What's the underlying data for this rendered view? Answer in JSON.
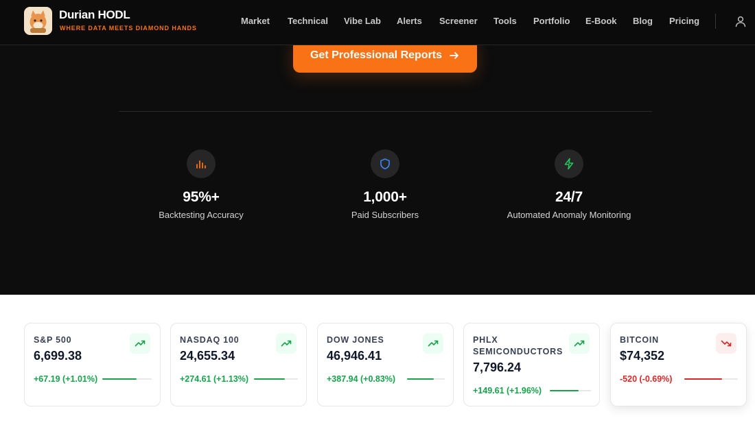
{
  "brand": {
    "title": "Durian HODL",
    "tagline": "WHERE DATA MEETS DIAMOND HANDS"
  },
  "nav": [
    {
      "label": "Market"
    },
    {
      "label": "Technical"
    },
    {
      "label": "Vibe Lab"
    },
    {
      "label": "Alerts"
    },
    {
      "label": "Screener"
    },
    {
      "label": "Tools"
    },
    {
      "label": "Portfolio"
    },
    {
      "label": "E-Book"
    },
    {
      "label": "Blog"
    },
    {
      "label": "Pricing"
    }
  ],
  "cta": {
    "label": "Get Professional Reports"
  },
  "stats": [
    {
      "value": "95%+",
      "label": "Backtesting Accuracy",
      "icon": "bar-chart-icon",
      "color": "#f97316"
    },
    {
      "value": "1,000+",
      "label": "Paid Subscribers",
      "icon": "shield-icon",
      "color": "#3b82f6"
    },
    {
      "value": "24/7",
      "label": "Automated Anomaly Monitoring",
      "icon": "lightning-icon",
      "color": "#22c55e"
    }
  ],
  "tickers": [
    {
      "name": "S&P 500",
      "value": "6,699.38",
      "change": "+67.19 (+1.01%)",
      "direction": "up",
      "bar_fill": 0.7
    },
    {
      "name": "NASDAQ 100",
      "value": "24,655.34",
      "change": "+274.61 (+1.13%)",
      "direction": "up",
      "bar_fill": 0.7
    },
    {
      "name": "DOW JONES",
      "value": "46,946.41",
      "change": "+387.94 (+0.83%)",
      "direction": "up",
      "bar_fill": 0.7
    },
    {
      "name": "PHLX SEMICONDUCTORS",
      "value": "7,796.24",
      "change": "+149.61 (+1.96%)",
      "direction": "up",
      "bar_fill": 0.7
    },
    {
      "name": "BITCOIN",
      "value": "$74,352",
      "change": "-520 (-0.69%)",
      "direction": "down",
      "bar_fill": 0.7
    }
  ],
  "colors": {
    "accent": "#f97316",
    "positive": "#16a34a",
    "negative": "#dc2626"
  }
}
